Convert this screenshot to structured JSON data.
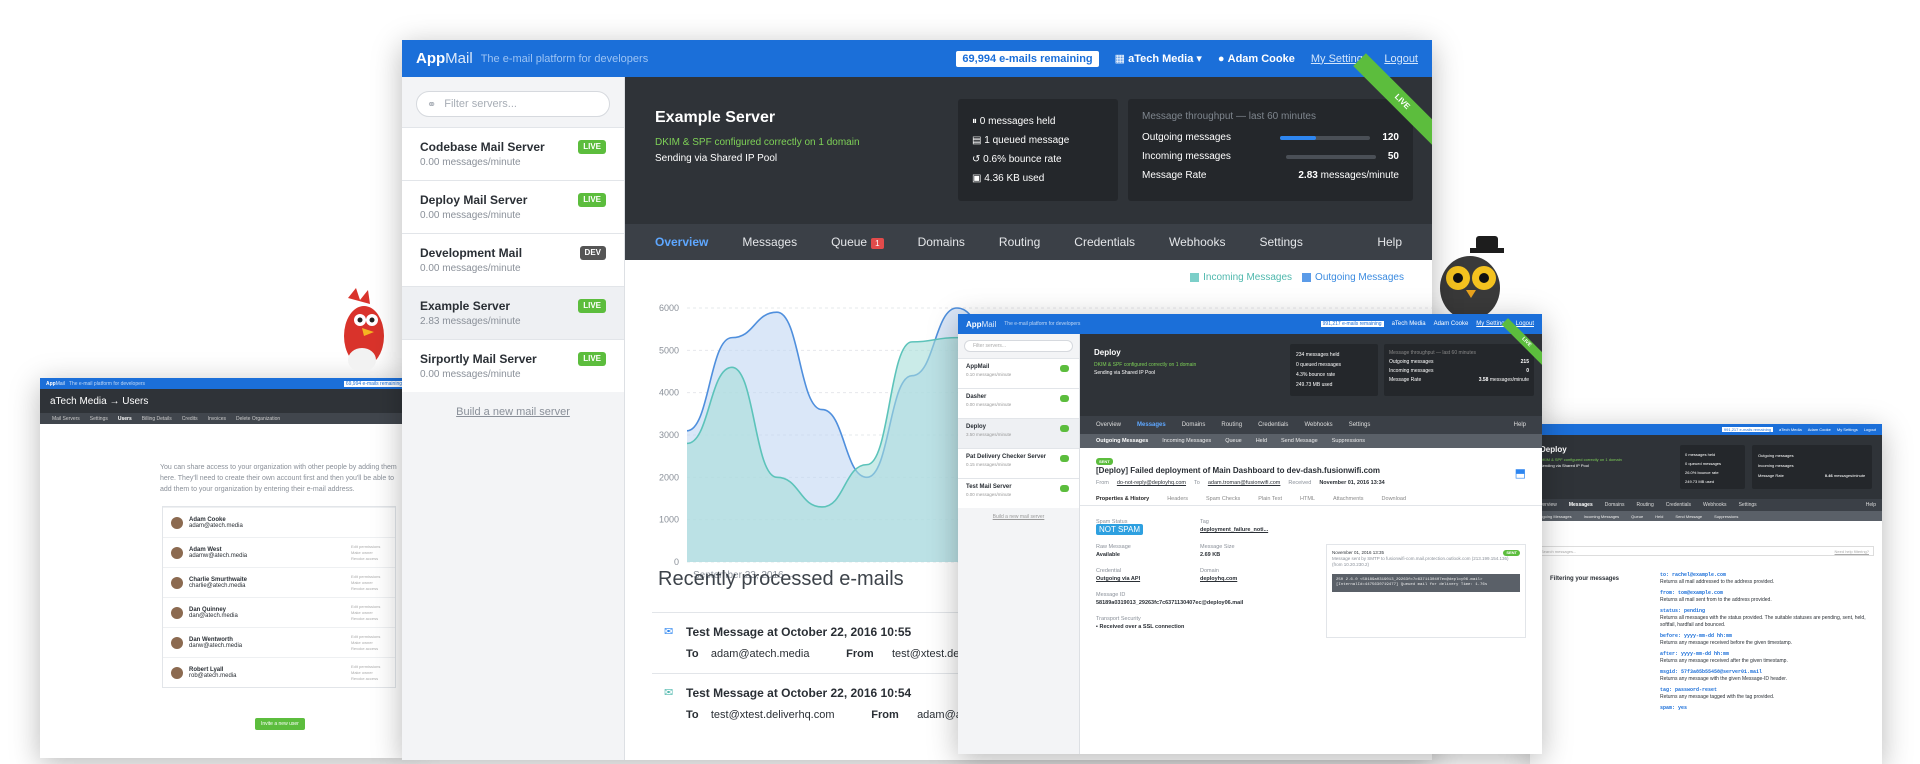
{
  "colors": {
    "brand_blue": "#1b6fd9",
    "live_green": "#5cbd3d",
    "dark_bg": "#2f3338",
    "incoming": "#7ccfc9",
    "outgoing": "#5b9be8"
  },
  "main": {
    "logo_app": "App",
    "logo_mail": "Mail",
    "tagline": "The e-mail platform for developers",
    "remaining": "69,994 e-mails remaining",
    "org": "aTech Media",
    "user": "Adam Cooke",
    "settings": "My Settings",
    "logout": "Logout",
    "search_placeholder": "Filter servers...",
    "servers": [
      {
        "name": "Codebase Mail Server",
        "rate": "0.00 messages/minute",
        "status": "LIVE"
      },
      {
        "name": "Deploy Mail Server",
        "rate": "0.00 messages/minute",
        "status": "LIVE"
      },
      {
        "name": "Development Mail",
        "rate": "0.00 messages/minute",
        "status": "DEV"
      },
      {
        "name": "Example Server",
        "rate": "2.83 messages/minute",
        "status": "LIVE"
      },
      {
        "name": "Sirportly Mail Server",
        "rate": "0.00 messages/minute",
        "status": "LIVE"
      }
    ],
    "build_link": "Build a new mail server",
    "server_title": "Example Server",
    "dkim": "DKIM & SPF configured correctly on 1 domain",
    "pool": "Sending via Shared IP Pool",
    "stats": {
      "held": "0 messages held",
      "queued": "1 queued message",
      "bounce": "0.6% bounce rate",
      "used": "4.36 KB used"
    },
    "throughput": {
      "heading": "Message throughput — last 60 minutes",
      "out_label": "Outgoing messages",
      "out_value": "120",
      "in_label": "Incoming messages",
      "in_value": "50",
      "rate_label": "Message Rate",
      "rate_value": "2.83",
      "rate_unit": "messages/minute",
      "outgoing_fill": 0.4,
      "incoming_fill": 0
    },
    "live": "LIVE",
    "nav": [
      "Overview",
      "Messages",
      "Queue",
      "Domains",
      "Routing",
      "Credentials",
      "Webhooks",
      "Settings"
    ],
    "queue_count": "1",
    "help": "Help",
    "legend_in": "Incoming Messages",
    "legend_out": "Outgoing Messages",
    "date_label": "September 23, 2016 →",
    "recent_title": "Recently processed e-mails",
    "messages": [
      {
        "subject": "Test Message at October 22, 2016 10:55",
        "to_label": "To",
        "to": "adam@atech.media",
        "from_label": "From",
        "from": "test@xtest.deliverh"
      },
      {
        "subject": "Test Message at October 22, 2016 10:54",
        "to_label": "To",
        "to": "test@xtest.deliverhq.com",
        "from_label": "From",
        "from": "adam@atech.m"
      }
    ]
  },
  "chart_data": {
    "type": "area",
    "ylim": [
      0,
      6000
    ],
    "yticks": [
      "6000",
      "5000",
      "4000",
      "3000",
      "2000",
      "1000",
      "0"
    ],
    "series": [
      {
        "name": "Incoming Messages",
        "values": [
          2800,
          4600,
          2000,
          1300,
          2300,
          5200,
          5300,
          3600,
          3000,
          1100,
          300,
          1700,
          3300
        ]
      },
      {
        "name": "Outgoing Messages",
        "values": [
          3100,
          5300,
          5900,
          3600,
          2000,
          4400,
          6000,
          4900,
          3300,
          1500,
          3400,
          4600,
          5400
        ]
      }
    ]
  },
  "left": {
    "logo_app": "App",
    "logo_mail": "Mail",
    "tagline": "The e-mail platform for developers",
    "remaining": "69,994 e-mails remaining",
    "crumb": "aTech Media → Users",
    "tabs": [
      "Mail Servers",
      "Settings",
      "Users",
      "Billing Details",
      "Credits",
      "Invoices",
      "Delete Organization"
    ],
    "intro": "You can share access to your organization with other people by adding them here. They'll need to create their own account first and then you'll be able to add them to your organization by entering their e-mail address.",
    "users": [
      {
        "name": "Adam Cooke",
        "email": "adam@atech.media"
      },
      {
        "name": "Adam West",
        "email": "adamw@atech.media"
      },
      {
        "name": "Charlie Smurthwaite",
        "email": "charlie@atech.media"
      },
      {
        "name": "Dan Quinney",
        "email": "dan@atech.media"
      },
      {
        "name": "Dan Wentworth",
        "email": "danw@atech.media"
      },
      {
        "name": "Robert Lyall",
        "email": "rob@atech.media"
      }
    ],
    "actions": "Edit permissions Make owner Revoke access",
    "invite": "Invite a new user"
  },
  "mid": {
    "logo_app": "App",
    "logo_mail": "Mail",
    "tagline": "The e-mail platform for developers",
    "remaining": "991,217 e-mails remaining",
    "org": "aTech Media",
    "user": "Adam Cooke",
    "settings": "My Settings",
    "logout": "Logout",
    "search": "Filter servers...",
    "servers": [
      {
        "name": "AppMail",
        "rate": "0.10 messages/minute"
      },
      {
        "name": "Dasher",
        "rate": "0.00 messages/minute"
      },
      {
        "name": "Deploy",
        "rate": "3.50 messages/minute"
      },
      {
        "name": "Pat Delivery Checker Server",
        "rate": "0.15 messages/minute"
      },
      {
        "name": "Test Mail Server",
        "rate": "0.00 messages/minute"
      }
    ],
    "build": "Build a new mail server",
    "title": "Deploy",
    "dkim": "DKIM & SPF configured correctly on 1 domain",
    "pool": "Sending via Shared IP Pool",
    "stats": [
      "234 messages held",
      "0 queued messages",
      "4.3% bounce rate",
      "249.73 MB used"
    ],
    "thr_heading": "Message throughput — last 60 minutes",
    "out": "Outgoing messages",
    "out_v": "215",
    "inc": "Incoming messages",
    "inc_v": "0",
    "rate": "Message Rate",
    "rate_v": "3.58",
    "rate_u": "messages/minute",
    "nav": [
      "Overview",
      "Messages",
      "Domains",
      "Routing",
      "Credentials",
      "Webhooks",
      "Settings"
    ],
    "help": "Help",
    "sub": [
      "Outgoing Messages",
      "Incoming Messages",
      "Queue",
      "Held",
      "Send Message",
      "Suppressions"
    ],
    "sent": "SENT",
    "subject": "[Deploy] Failed deployment of Main Dashboard to dev-dash.fusionwifi.com",
    "from_l": "From",
    "from": "do-not-reply@deployhq.com",
    "to_l": "To",
    "to": "adam.troman@fusionwifi.com",
    "rec_l": "Received",
    "received": "November 01, 2016 13:34",
    "tabs": [
      "Properties & History",
      "Headers",
      "Spam Checks",
      "Plain Text",
      "HTML",
      "Attachments",
      "Download"
    ],
    "spam_l": "Spam Status",
    "spam": "NOT SPAM",
    "tag_l": "Tag",
    "tag": "deployment_failure_noti...",
    "raw_l": "Raw Message",
    "raw": "Available",
    "size_l": "Message Size",
    "size": "2.69 KB",
    "cred_l": "Credential",
    "cred": "Outgoing via API",
    "dom_l": "Domain",
    "dom": "deployhq.com",
    "id_l": "Message ID",
    "id": "58189a0319013_29263fc7c6371130407ec@deploy06.mail",
    "ts_l": "Transport Security",
    "ts": "Received over a SSL connection",
    "event_date": "November 01, 2016 13:35",
    "event_badge": "SENT",
    "event_text": "Message sent by SMTP to fusionwifi-com.mail.protection.outlook.com (213.199.154.136) (from 10.20.230.2)",
    "event_code": "250 2.6.0 <58189a0319013_29263fc7c6371130407ec@deploy06.mail> [InternalId=4475630719477] Queued mail for delivery Time: 1.76s"
  },
  "right": {
    "remaining": "991,217 e-mails remaining",
    "org": "aTech Media",
    "user": "Adam Cooke",
    "settings": "My Settings",
    "logout": "Logout",
    "title": "Deploy",
    "dkim": "DKIM & SPF configured correctly on 1 domain",
    "pool": "Sending via Shared IP Pool",
    "stats": [
      "0 messages held",
      "0 queued messages",
      "26.0% bounce rate",
      "249.73 MB used"
    ],
    "out": "Outgoing messages",
    "inc": "Incoming messages",
    "rate": "Message Rate",
    "rate_v": "0.46",
    "rate_u": "messages/minute",
    "nav": [
      "Overview",
      "Messages",
      "Domains",
      "Routing",
      "Credentials",
      "Webhooks",
      "Settings"
    ],
    "help": "Help",
    "sub": [
      "Outgoing Messages",
      "Incoming Messages",
      "Queue",
      "Held",
      "Send Message",
      "Suppressions"
    ],
    "search_hint": "Search messages...",
    "need_help": "Need help filtering?",
    "filter_title": "Filtering your messages",
    "filters": [
      {
        "k": "to: rachel@example.com",
        "d": "Returns all mail addressed to the address provided."
      },
      {
        "k": "from: tom@example.com",
        "d": "Returns all mail sent from to the address provided."
      },
      {
        "k": "status: pending",
        "d": "Returns all messages with the status provided. The suitable statuses are pending, sent, held, softfail, hardfail and bounced."
      },
      {
        "k": "before: yyyy-mm-dd hh:mm",
        "d": "Returns any message received before the given timestamp."
      },
      {
        "k": "after: yyyy-mm-dd hh:mm",
        "d": "Returns any message received after the given timestamp."
      },
      {
        "k": "msgid: 57f3a85b55458@server01.mail",
        "d": "Returns any message with the given Message-ID header."
      },
      {
        "k": "tag: password-reset",
        "d": "Returns any message tagged with the tag provided."
      },
      {
        "k": "spam: yes",
        "d": ""
      }
    ]
  }
}
